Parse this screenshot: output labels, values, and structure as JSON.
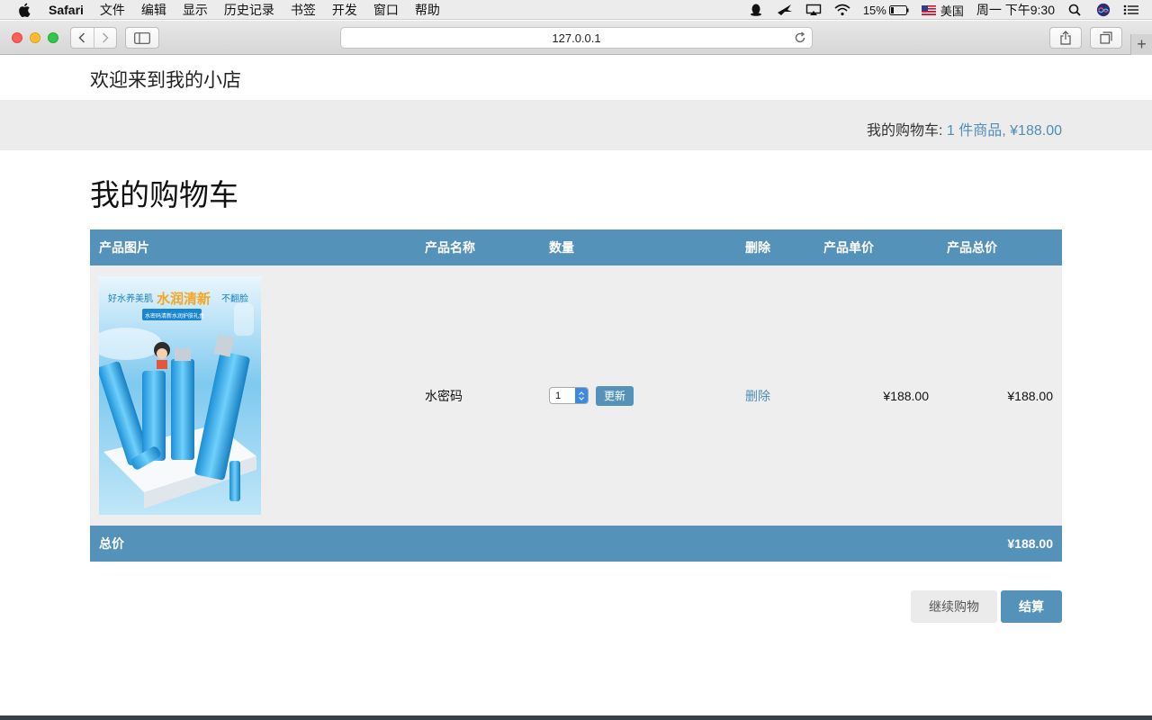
{
  "menubar": {
    "app": "Safari",
    "items": [
      "文件",
      "编辑",
      "显示",
      "历史记录",
      "书签",
      "开发",
      "窗口",
      "帮助"
    ],
    "battery": "15%",
    "input_source": "美国",
    "clock": "周一 下午9:30"
  },
  "browser": {
    "url": "127.0.0.1",
    "new_tab_symbol": "+"
  },
  "site": {
    "title": "欢迎来到我的小店"
  },
  "cart_summary": {
    "label": "我的购物车: ",
    "link": "1 件商品, ¥188.00"
  },
  "page_heading": "我的购物车",
  "table": {
    "headers": [
      "产品图片",
      "产品名称",
      "数量",
      "删除",
      "产品单价",
      "产品总价"
    ],
    "rows": [
      {
        "image_caption_top": "好水养美肌",
        "image_caption_highlight": "水润清新",
        "image_caption_end": "不翻脸",
        "image_subcaption": "水密码清新水润护肤礼盒",
        "name": "水密码",
        "quantity": "1",
        "update_label": "更新",
        "remove_label": "删除",
        "unit_price": "¥188.00",
        "total_price": "¥188.00"
      }
    ],
    "footer_label": "总价",
    "footer_total": "¥188.00"
  },
  "buttons": {
    "continue": "继续购物",
    "checkout": "结算"
  },
  "colors": {
    "accent": "#5592ba",
    "link": "#4f8db5",
    "row_bg": "#eeeeee",
    "bar_bg": "#ececec"
  }
}
